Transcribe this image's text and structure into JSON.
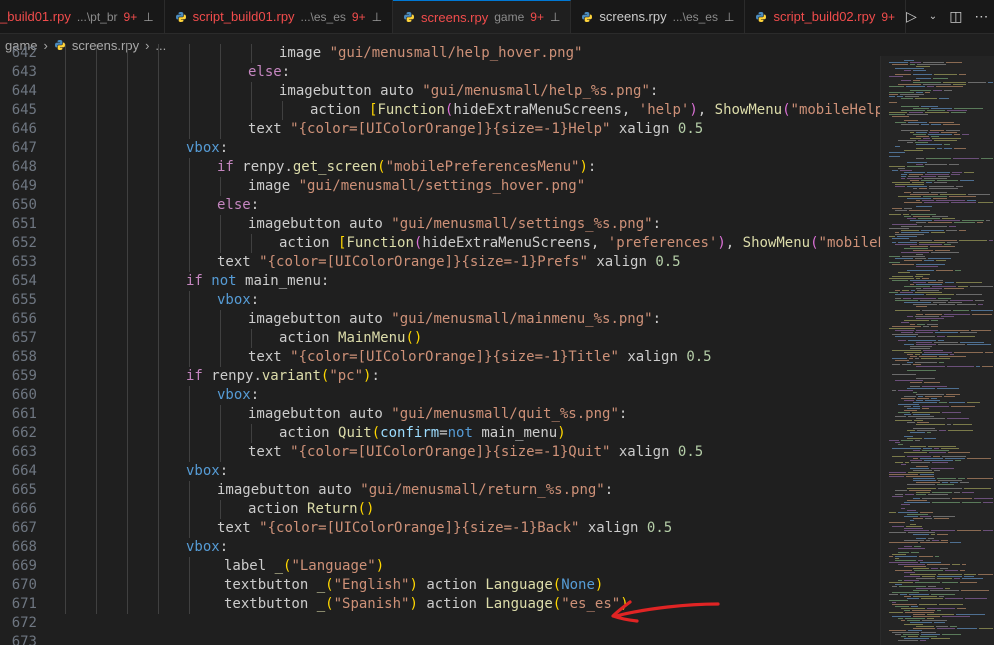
{
  "tabs": [
    {
      "name": "_build01.rpy",
      "desc": "...\\pt_br",
      "count": "9+",
      "active": false,
      "plain": false
    },
    {
      "name": "script_build01.rpy",
      "desc": "...\\es_es",
      "count": "9+",
      "active": false,
      "plain": false
    },
    {
      "name": "screens.rpy",
      "desc": "game",
      "count": "9+",
      "active": true,
      "plain": false
    },
    {
      "name": "screens.rpy",
      "desc": "...\\es_es",
      "count": "",
      "active": false,
      "plain": true
    },
    {
      "name": "script_build02.rpy",
      "desc": "",
      "count": "9+",
      "active": false,
      "plain": false
    }
  ],
  "breadcrumb": {
    "folder": "game",
    "file": "screens.rpy",
    "more": "..."
  },
  "colors": {
    "accent": "#0078d4",
    "error": "#f14c4c",
    "annotation": "#e02424"
  },
  "icons": [
    "pin-icon",
    "python-file-icon",
    "run-icon",
    "chevron-down-icon",
    "split-editor-icon",
    "more-actions-icon",
    "chevron-right-icon"
  ],
  "editor": {
    "lines": [
      {
        "n": "642",
        "indent": 7,
        "tokens": [
          [
            "var",
            "image "
          ],
          [
            "str",
            "\"gui/menusmall/help_hover.png\""
          ]
        ]
      },
      {
        "n": "643",
        "indent": 6,
        "tokens": [
          [
            "ctl",
            "else"
          ],
          [
            "var",
            ":"
          ]
        ]
      },
      {
        "n": "644",
        "indent": 7,
        "tokens": [
          [
            "var",
            "imagebutton auto "
          ],
          [
            "str",
            "\"gui/menusmall/help_%s.png\""
          ],
          [
            "var",
            ":"
          ]
        ]
      },
      {
        "n": "645",
        "indent": 8,
        "tokens": [
          [
            "var",
            "action "
          ],
          [
            "br1",
            "["
          ],
          [
            "fn",
            "Function"
          ],
          [
            "br2",
            "("
          ],
          [
            "var",
            "hideExtraMenuScreens, "
          ],
          [
            "str",
            "'help'"
          ],
          [
            "br2",
            ")"
          ],
          [
            "var",
            ", "
          ],
          [
            "fn",
            "ShowMenu"
          ],
          [
            "br2",
            "("
          ],
          [
            "str",
            "\"mobileHelpMenu\""
          ],
          [
            "br2",
            ")"
          ]
        ]
      },
      {
        "n": "646",
        "indent": 6,
        "tokens": [
          [
            "var",
            "text "
          ],
          [
            "str",
            "\"{color=[UIColorOrange]}{size=-1}Help\""
          ],
          [
            "var",
            " xalign "
          ],
          [
            "num",
            "0.5"
          ]
        ]
      },
      {
        "n": "647",
        "indent": 4,
        "tokens": [
          [
            "kw",
            "vbox"
          ],
          [
            "var",
            ":"
          ]
        ]
      },
      {
        "n": "648",
        "indent": 5,
        "tokens": [
          [
            "ctl",
            "if "
          ],
          [
            "var",
            "renpy."
          ],
          [
            "fn",
            "get_screen"
          ],
          [
            "br1",
            "("
          ],
          [
            "str",
            "\"mobilePreferencesMenu\""
          ],
          [
            "br1",
            ")"
          ],
          [
            "var",
            ":"
          ]
        ]
      },
      {
        "n": "649",
        "indent": 6,
        "tokens": [
          [
            "var",
            "image "
          ],
          [
            "str",
            "\"gui/menusmall/settings_hover.png\""
          ]
        ]
      },
      {
        "n": "650",
        "indent": 5,
        "tokens": [
          [
            "ctl",
            "else"
          ],
          [
            "var",
            ":"
          ]
        ]
      },
      {
        "n": "651",
        "indent": 6,
        "tokens": [
          [
            "var",
            "imagebutton auto "
          ],
          [
            "str",
            "\"gui/menusmall/settings_%s.png\""
          ],
          [
            "var",
            ":"
          ]
        ]
      },
      {
        "n": "652",
        "indent": 7,
        "tokens": [
          [
            "var",
            "action "
          ],
          [
            "br1",
            "["
          ],
          [
            "fn",
            "Function"
          ],
          [
            "br2",
            "("
          ],
          [
            "var",
            "hideExtraMenuScreens, "
          ],
          [
            "str",
            "'preferences'"
          ],
          [
            "br2",
            ")"
          ],
          [
            "var",
            ", "
          ],
          [
            "fn",
            "ShowMenu"
          ],
          [
            "br2",
            "("
          ],
          [
            "str",
            "\"mobilePrefere"
          ]
        ]
      },
      {
        "n": "653",
        "indent": 5,
        "tokens": [
          [
            "var",
            "text "
          ],
          [
            "str",
            "\"{color=[UIColorOrange]}{size=-1}Prefs\""
          ],
          [
            "var",
            " xalign "
          ],
          [
            "num",
            "0.5"
          ]
        ]
      },
      {
        "n": "654",
        "indent": 4,
        "tokens": [
          [
            "ctl",
            "if "
          ],
          [
            "kw",
            "not"
          ],
          [
            "var",
            " main_menu:"
          ]
        ]
      },
      {
        "n": "655",
        "indent": 5,
        "tokens": [
          [
            "kw",
            "vbox"
          ],
          [
            "var",
            ":"
          ]
        ]
      },
      {
        "n": "656",
        "indent": 6,
        "tokens": [
          [
            "var",
            "imagebutton auto "
          ],
          [
            "str",
            "\"gui/menusmall/mainmenu_%s.png\""
          ],
          [
            "var",
            ":"
          ]
        ]
      },
      {
        "n": "657",
        "indent": 7,
        "tokens": [
          [
            "var",
            "action "
          ],
          [
            "fn",
            "MainMenu"
          ],
          [
            "br1",
            "()"
          ]
        ]
      },
      {
        "n": "658",
        "indent": 6,
        "tokens": [
          [
            "var",
            "text "
          ],
          [
            "str",
            "\"{color=[UIColorOrange]}{size=-1}Title\""
          ],
          [
            "var",
            " xalign "
          ],
          [
            "num",
            "0.5"
          ]
        ]
      },
      {
        "n": "659",
        "indent": 4,
        "tokens": [
          [
            "ctl",
            "if "
          ],
          [
            "var",
            "renpy."
          ],
          [
            "fn",
            "variant"
          ],
          [
            "br1",
            "("
          ],
          [
            "str",
            "\"pc\""
          ],
          [
            "br1",
            ")"
          ],
          [
            "var",
            ":"
          ]
        ]
      },
      {
        "n": "660",
        "indent": 5,
        "tokens": [
          [
            "kw",
            "vbox"
          ],
          [
            "var",
            ":"
          ]
        ]
      },
      {
        "n": "661",
        "indent": 6,
        "tokens": [
          [
            "var",
            "imagebutton auto "
          ],
          [
            "str",
            "\"gui/menusmall/quit_%s.png\""
          ],
          [
            "var",
            ":"
          ]
        ]
      },
      {
        "n": "662",
        "indent": 7,
        "tokens": [
          [
            "var",
            "action "
          ],
          [
            "fn",
            "Quit"
          ],
          [
            "br1",
            "("
          ],
          [
            "prm",
            "confirm"
          ],
          [
            "var",
            "="
          ],
          [
            "kw",
            "not"
          ],
          [
            "var",
            " main_menu"
          ],
          [
            "br1",
            ")"
          ]
        ]
      },
      {
        "n": "663",
        "indent": 6,
        "tokens": [
          [
            "var",
            "text "
          ],
          [
            "str",
            "\"{color=[UIColorOrange]}{size=-1}Quit\""
          ],
          [
            "var",
            " xalign "
          ],
          [
            "num",
            "0.5"
          ]
        ]
      },
      {
        "n": "664",
        "indent": 4,
        "tokens": [
          [
            "kw",
            "vbox"
          ],
          [
            "var",
            ":"
          ]
        ]
      },
      {
        "n": "665",
        "indent": 5,
        "tokens": [
          [
            "var",
            "imagebutton auto "
          ],
          [
            "str",
            "\"gui/menusmall/return_%s.png\""
          ],
          [
            "var",
            ":"
          ]
        ]
      },
      {
        "n": "666",
        "indent": 6,
        "tokens": [
          [
            "var",
            "action "
          ],
          [
            "fn",
            "Return"
          ],
          [
            "br1",
            "()"
          ]
        ]
      },
      {
        "n": "667",
        "indent": 5,
        "tokens": [
          [
            "var",
            "text "
          ],
          [
            "str",
            "\"{color=[UIColorOrange]}{size=-1}Back\""
          ],
          [
            "var",
            " xalign "
          ],
          [
            "num",
            "0.5"
          ]
        ]
      },
      {
        "n": "668",
        "indent": 4,
        "tokens": [
          [
            "kw",
            "vbox"
          ],
          [
            "var",
            ":"
          ]
        ]
      },
      {
        "n": "669",
        "indent": 5,
        "pad": 1,
        "tokens": [
          [
            "var",
            "label "
          ],
          [
            "fn",
            "_"
          ],
          [
            "br1",
            "("
          ],
          [
            "str",
            "\"Language\""
          ],
          [
            "br1",
            ")"
          ]
        ]
      },
      {
        "n": "670",
        "indent": 5,
        "pad": 1,
        "tokens": [
          [
            "var",
            "textbutton "
          ],
          [
            "fn",
            "_"
          ],
          [
            "br1",
            "("
          ],
          [
            "str",
            "\"English\""
          ],
          [
            "br1",
            ")"
          ],
          [
            "var",
            " action "
          ],
          [
            "fn",
            "Language"
          ],
          [
            "br1",
            "("
          ],
          [
            "kw",
            "None"
          ],
          [
            "br1",
            ")"
          ]
        ]
      },
      {
        "n": "671",
        "indent": 5,
        "pad": 1,
        "tokens": [
          [
            "var",
            "textbutton "
          ],
          [
            "fn",
            "_"
          ],
          [
            "br1",
            "("
          ],
          [
            "str",
            "\"Spanish\""
          ],
          [
            "br1",
            ")"
          ],
          [
            "var",
            " action "
          ],
          [
            "fn",
            "Language"
          ],
          [
            "br1",
            "("
          ],
          [
            "str",
            "\"es_es\""
          ],
          [
            "br1",
            ")"
          ]
        ]
      },
      {
        "n": "672",
        "indent": 0,
        "tokens": []
      },
      {
        "n": "673",
        "indent": 0,
        "tokens": []
      }
    ]
  }
}
